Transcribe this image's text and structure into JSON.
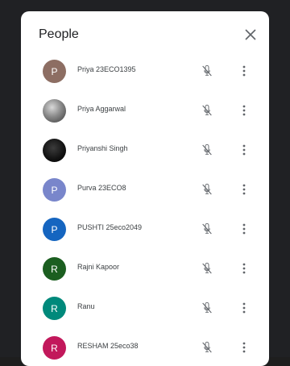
{
  "panel": {
    "title": "People",
    "close_icon": "close-icon"
  },
  "participants": [
    {
      "name": "Priya 23ECO1395",
      "initial": "P",
      "color": "#8d6e63",
      "avatar_type": "initial"
    },
    {
      "name": "Priya Aggarwal",
      "initial": "",
      "color": "#7a7a7a",
      "avatar_type": "photo-1"
    },
    {
      "name": "Priyanshi Singh",
      "initial": "",
      "color": "#111111",
      "avatar_type": "photo-2"
    },
    {
      "name": "Purva 23ECO8",
      "initial": "P",
      "color": "#7986cb",
      "avatar_type": "initial"
    },
    {
      "name": "PUSHTI 25eco2049",
      "initial": "P",
      "color": "#1565c0",
      "avatar_type": "initial"
    },
    {
      "name": "Rajni Kapoor",
      "initial": "R",
      "color": "#1b5e20",
      "avatar_type": "initial"
    },
    {
      "name": "Ranu",
      "initial": "R",
      "color": "#00897b",
      "avatar_type": "initial"
    },
    {
      "name": "RESHAM 25eco38",
      "initial": "R",
      "color": "#c2185b",
      "avatar_type": "initial"
    }
  ],
  "icons": {
    "mute": "mic-off-icon",
    "more": "more-vert-icon"
  }
}
